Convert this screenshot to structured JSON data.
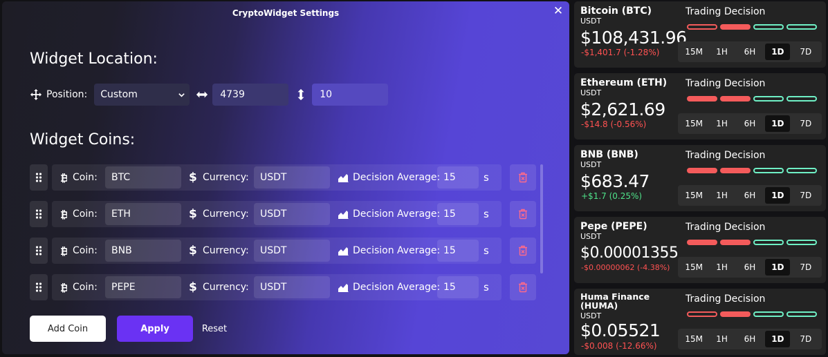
{
  "modal": {
    "title": "CryptoWidget Settings",
    "close_label": "✕",
    "location_title": "Widget Location:",
    "position_label": "Position:",
    "position_value": "Custom",
    "x_value": "4739",
    "y_value": "10",
    "coins_title": "Widget Coins:",
    "coin_label": "Coin:",
    "currency_label": "Currency:",
    "avg_label": "Decision Average:",
    "avg_unit": "s",
    "coins": [
      {
        "coin": "BTC",
        "currency": "USDT",
        "avg": "15"
      },
      {
        "coin": "ETH",
        "currency": "USDT",
        "avg": "15"
      },
      {
        "coin": "BNB",
        "currency": "USDT",
        "avg": "15"
      },
      {
        "coin": "PEPE",
        "currency": "USDT",
        "avg": "15"
      }
    ],
    "add_coin_label": "Add Coin",
    "apply_label": "Apply",
    "reset_label": "Reset"
  },
  "widgets": [
    {
      "name": "Bitcoin (BTC)",
      "quote": "USDT",
      "price": "$108,431.96",
      "change": "-$1,401.7 (-1.28%)",
      "direction": "down",
      "decision_label": "Trading Decision",
      "bars": [
        "sell-outline",
        "sell-solid",
        "buy-outline",
        "buy-outline"
      ],
      "timeframes": [
        "15M",
        "1H",
        "6H",
        "1D",
        "7D"
      ],
      "active_tf": "1D"
    },
    {
      "name": "Ethereum (ETH)",
      "quote": "USDT",
      "price": "$2,621.69",
      "change": "-$14.8 (-0.56%)",
      "direction": "down",
      "decision_label": "Trading Decision",
      "bars": [
        "sell-solid",
        "sell-solid",
        "buy-outline",
        "buy-outline"
      ],
      "timeframes": [
        "15M",
        "1H",
        "6H",
        "1D",
        "7D"
      ],
      "active_tf": "1D"
    },
    {
      "name": "BNB (BNB)",
      "quote": "USDT",
      "price": "$683.47",
      "change": "+$1.7 (0.25%)",
      "direction": "up",
      "decision_label": "Trading Decision",
      "bars": [
        "sell-solid",
        "sell-solid",
        "buy-outline",
        "buy-outline"
      ],
      "timeframes": [
        "15M",
        "1H",
        "6H",
        "1D",
        "7D"
      ],
      "active_tf": "1D"
    },
    {
      "name": "Pepe (PEPE)",
      "quote": "USDT",
      "price": "$0.00001355",
      "change": "-$0.00000062 (-4.38%)",
      "direction": "down",
      "decision_label": "Trading Decision",
      "bars": [
        "sell-solid",
        "sell-solid",
        "buy-outline",
        "buy-outline"
      ],
      "timeframes": [
        "15M",
        "1H",
        "6H",
        "1D",
        "7D"
      ],
      "active_tf": "1D"
    },
    {
      "name": "Huma Finance (HUMA)",
      "quote": "USDT",
      "price": "$0.05521",
      "change": "-$0.008 (-12.66%)",
      "direction": "down",
      "decision_label": "Trading Decision",
      "bars": [
        "sell-outline",
        "sell-solid",
        "buy-outline",
        "buy-outline"
      ],
      "timeframes": [
        "15M",
        "1H",
        "6H",
        "1D",
        "7D"
      ],
      "active_tf": "1D"
    }
  ],
  "colors": {
    "accent": "#6a32f3",
    "sell": "#f45b5b",
    "buy": "#6ff0c5",
    "up": "#4fe38a",
    "down": "#ff5252"
  }
}
